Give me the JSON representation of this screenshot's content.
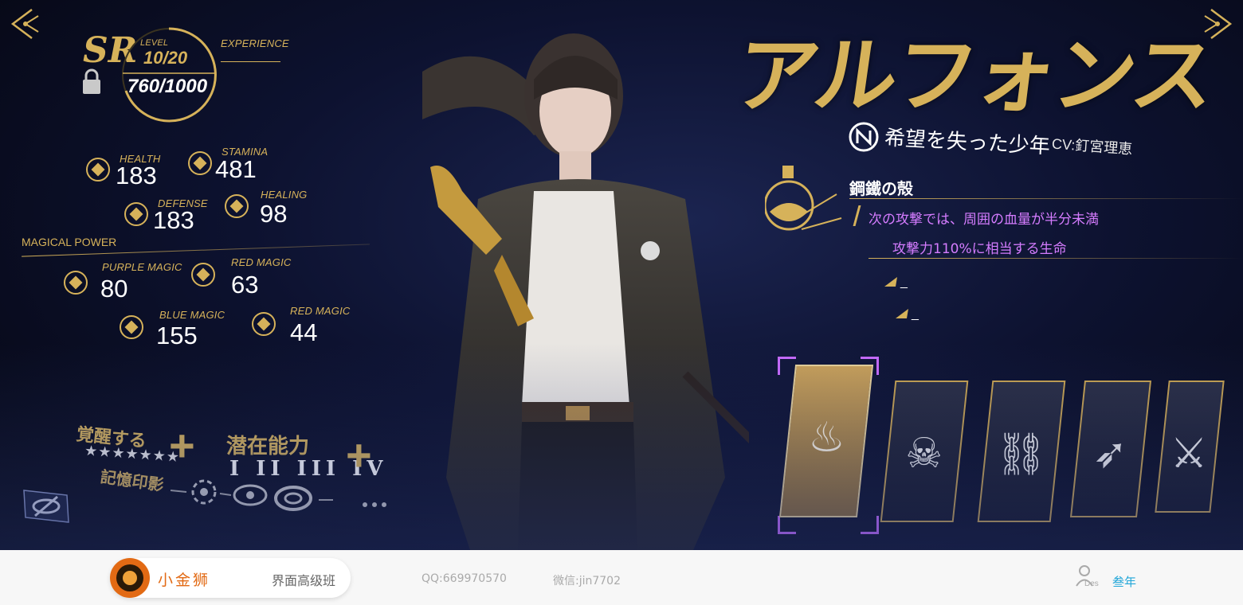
{
  "hud": {
    "rarity": "SR",
    "level_label": "LEVEL",
    "level_value": "10/20",
    "experience_label": "EXPERIENCE",
    "experience_value": "760/1000"
  },
  "stats": [
    {
      "label": "HEALTH",
      "value": "183"
    },
    {
      "label": "STAMINA",
      "value": "481"
    },
    {
      "label": "DEFENSE",
      "value": "183"
    },
    {
      "label": "HEALING",
      "value": "98"
    }
  ],
  "magic": {
    "title": "MAGICAL POWER",
    "items": [
      {
        "label": "PURPLE MAGIC",
        "value": "80"
      },
      {
        "label": "RED MAGIC",
        "value": "63"
      },
      {
        "label": "BLUE MAGIC",
        "value": "155"
      },
      {
        "label": "RED MAGIC",
        "value": "44"
      }
    ]
  },
  "progression": {
    "awaken_label": "覚醒する",
    "awaken_stars": "★★★★★★★",
    "potential_label": "潜在能力",
    "potential_levels": "I II III IV",
    "memory_label": "記憶印影",
    "plus": "+"
  },
  "character": {
    "name": "アルフォンス",
    "subtitle": "希望を失った少年",
    "cv": "CV:釘宮理恵"
  },
  "skill": {
    "name": "鋼鐵の殻",
    "desc_line1": "次の攻撃では、周囲の血量が半分未満",
    "desc_line2": "攻撃力110%に相当する生命",
    "placeholder1": "_",
    "placeholder2": "_"
  },
  "skill_cards": [
    {
      "icon": "potion-icon",
      "glyph": "♨",
      "active": true
    },
    {
      "icon": "skull-icon",
      "glyph": "☠",
      "active": false
    },
    {
      "icon": "broken-chain-icon",
      "glyph": "⛓",
      "active": false
    },
    {
      "icon": "archer-icon",
      "glyph": "➶",
      "active": false
    },
    {
      "icon": "slash-icon",
      "glyph": "⚔",
      "active": false
    }
  ],
  "footer": {
    "brand_name": "小金狮",
    "course": "界面高级班",
    "qq": "QQ:669970570",
    "wechat": "微信:jin7702",
    "user_small": "Des",
    "user_name": "叁年"
  },
  "colors": {
    "gold": "#d6b25a",
    "skill_text": "#d57cff",
    "active_bracket": "#c86bff",
    "brand_orange": "#e26a14",
    "user_blue": "#20a6d8"
  }
}
